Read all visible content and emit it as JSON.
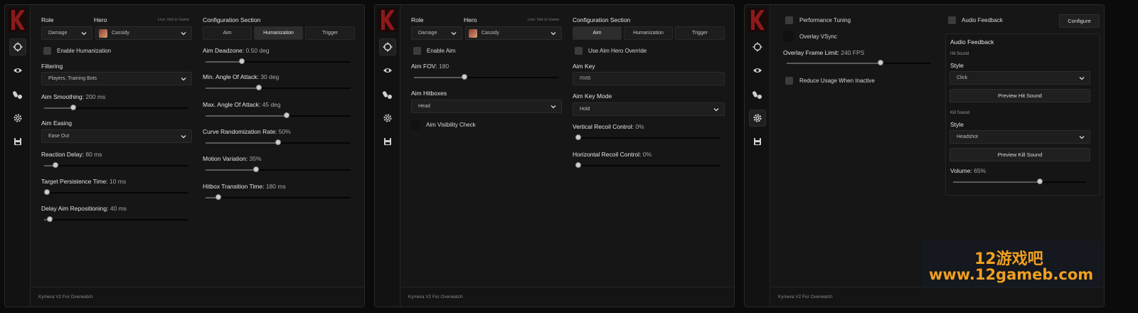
{
  "app": {
    "footer": "Kymera V2 For Overwatch",
    "status": "Live: Not In Game"
  },
  "panel1": {
    "role_label": "Role",
    "role_value": "Damage",
    "hero_label": "Hero",
    "hero_value": "Cassidy",
    "enable_humanization": "Enable Humanization",
    "filtering_label": "Filtering",
    "filtering_value": "Players, Training Bots",
    "aim_smoothing": {
      "label": "Aim Smoothing:",
      "value": "200 ms",
      "fraction": 0.2
    },
    "aim_easing_label": "Aim Easing",
    "aim_easing_value": "Ease Out",
    "reaction_delay": {
      "label": "Reaction Delay:",
      "value": "80 ms",
      "fraction": 0.08
    },
    "target_persistence": {
      "label": "Target Persistence Time:",
      "value": "10 ms",
      "fraction": 0.0
    },
    "delay_aim_repositioning": {
      "label": "Delay Aim Repositioning:",
      "value": "40 ms",
      "fraction": 0.04
    },
    "config_title": "Configuration Section",
    "tabs": [
      "Aim",
      "Humanization",
      "Trigger"
    ],
    "aim_deadzone": {
      "label": "Aim Deadzone:",
      "value": "0.50 deg",
      "fraction": 0.25
    },
    "min_angle": {
      "label": "Min. Angle Of Attack:",
      "value": "30 deg",
      "fraction": 0.37
    },
    "max_angle": {
      "label": "Max. Angle Of Attack:",
      "value": "45 deg",
      "fraction": 0.56
    },
    "curve_random": {
      "label": "Curve Randomization Rate:",
      "value": "50%",
      "fraction": 0.5
    },
    "motion_variation": {
      "label": "Motion Variation:",
      "value": "35%",
      "fraction": 0.35
    },
    "hitbox_transition": {
      "label": "Hitbox Transition Time:",
      "value": "180 ms",
      "fraction": 0.09
    }
  },
  "panel2": {
    "role_label": "Role",
    "role_value": "Damage",
    "hero_label": "Hero",
    "hero_value": "Cassidy",
    "enable_aim": "Enable Aim",
    "aim_fov": {
      "label": "Aim FOV:",
      "value": "180",
      "fraction": 0.35
    },
    "aim_hitboxes_label": "Aim Hitboxes",
    "aim_hitboxes_value": "Head",
    "aim_visibility_check": "Aim Visibility Check",
    "config_title": "Configuration Section",
    "tabs": [
      "Aim",
      "Humanization",
      "Trigger"
    ],
    "use_override": "Use Aim Hero Override",
    "aim_key_label": "Aim Key",
    "aim_key_value": "RMB",
    "aim_key_mode_label": "Aim Key Mode",
    "aim_key_mode_value": "Hold",
    "vertical_recoil": {
      "label": "Vertical Recoil Control:",
      "value": "0%",
      "fraction": 0.0
    },
    "horizontal_recoil": {
      "label": "Horizontal Recoil Control:",
      "value": "0%",
      "fraction": 0.0
    }
  },
  "panel3": {
    "performance_tuning": "Performance Tuning",
    "overlay_vsync": "Overlay VSync",
    "overlay_frame_limit": {
      "label": "Overlay Frame Limit:",
      "value": "240 FPS",
      "fraction": 0.65
    },
    "reduce_usage": "Reduce Usage When Inactive",
    "audio_feedback": "Audio Feedback",
    "configure": "Configure",
    "audio_title": "Audio Feedback",
    "hit_sound_label": "Hit Sound",
    "hit_style_label": "Style",
    "hit_style_value": "Click",
    "preview_hit": "Preview Hit Sound",
    "kill_sound_label": "Kill Sound",
    "kill_style_label": "Style",
    "kill_style_value": "Headshot",
    "preview_kill": "Preview Kill Sound",
    "volume": {
      "label": "Volume:",
      "value": "65%",
      "fraction": 0.65
    }
  },
  "watermark": {
    "line1": "12游戏吧",
    "line2": "www.12gameb.com"
  },
  "colors": {
    "background": "#0b0b0b",
    "panel": "#161616",
    "knob": "#cfcfcf",
    "logo_red": "#8b1a1a",
    "watermark": "#f0a020"
  }
}
